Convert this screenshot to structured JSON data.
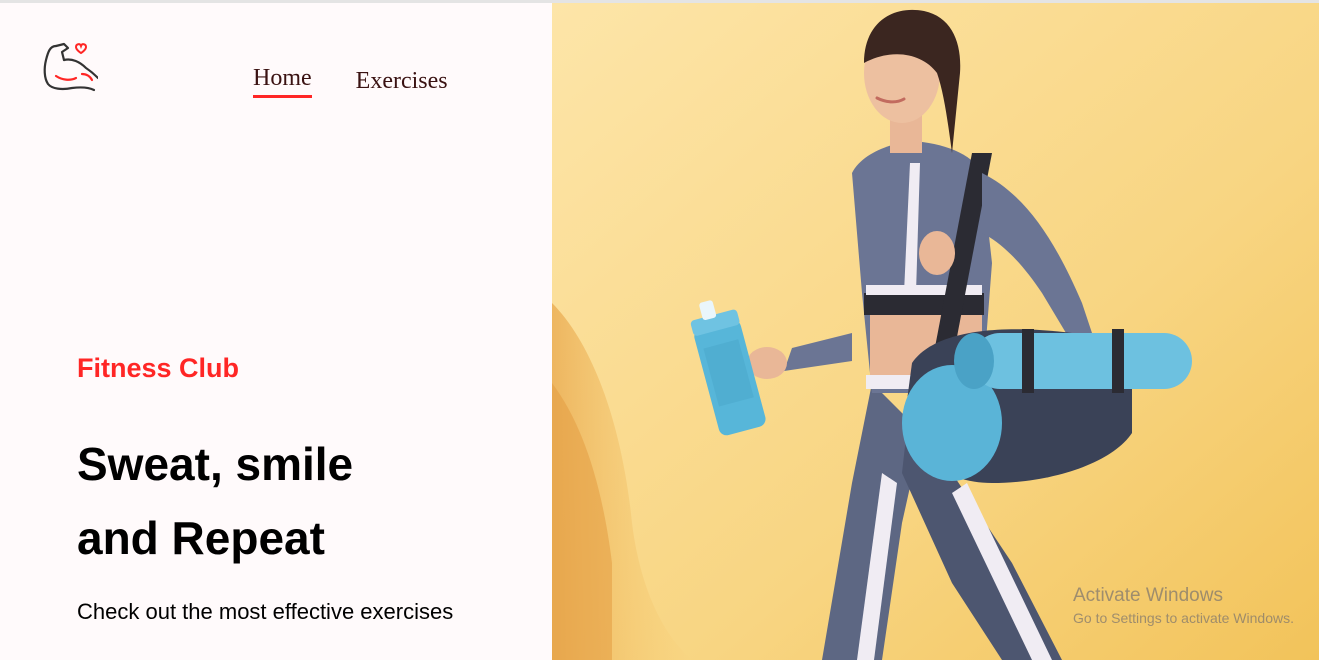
{
  "brand": {
    "logo_icon": "flexed-arm-heart-icon"
  },
  "nav": {
    "items": [
      {
        "label": "Home",
        "active": true
      },
      {
        "label": "Exercises",
        "active": false
      }
    ]
  },
  "hero_text": {
    "eyebrow": "Fitness Club",
    "headline_line1": "Sweat, smile",
    "headline_line2": "and Repeat",
    "tagline": "Check out the most effective exercises"
  },
  "hero_image": {
    "description_icon": "fitness-woman-photo",
    "background_color": "#f7d27c"
  },
  "system_overlay": {
    "title": "Activate Windows",
    "subtitle": "Go to Settings to activate Windows."
  },
  "colors": {
    "accent": "#ff2625",
    "nav_text": "#3a1212",
    "page_bg": "#fffafb"
  }
}
